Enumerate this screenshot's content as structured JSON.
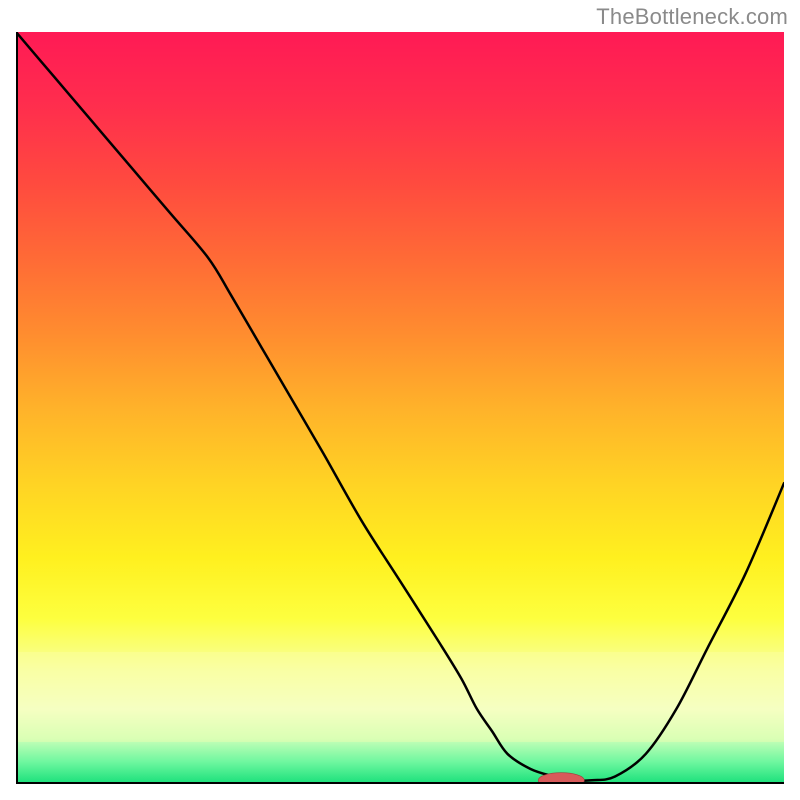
{
  "watermark": "TheBottleneck.com",
  "chart_data": {
    "type": "line",
    "title": "",
    "xlabel": "",
    "ylabel": "",
    "xlim": [
      0,
      100
    ],
    "ylim": [
      0,
      100
    ],
    "grid": false,
    "legend": false,
    "background_gradient": {
      "stops": [
        {
          "offset": 0.0,
          "color": "#ff1a55"
        },
        {
          "offset": 0.1,
          "color": "#ff2e4d"
        },
        {
          "offset": 0.2,
          "color": "#ff4a3f"
        },
        {
          "offset": 0.3,
          "color": "#ff6a36"
        },
        {
          "offset": 0.4,
          "color": "#ff8c2f"
        },
        {
          "offset": 0.5,
          "color": "#ffb22a"
        },
        {
          "offset": 0.6,
          "color": "#ffd324"
        },
        {
          "offset": 0.7,
          "color": "#fff01f"
        },
        {
          "offset": 0.78,
          "color": "#fdff3f"
        },
        {
          "offset": 0.85,
          "color": "#f8ffa0"
        },
        {
          "offset": 0.9,
          "color": "#f2ffcc"
        },
        {
          "offset": 0.94,
          "color": "#c8ffb8"
        },
        {
          "offset": 0.97,
          "color": "#70f7a0"
        },
        {
          "offset": 1.0,
          "color": "#18e07a"
        }
      ]
    },
    "series": [
      {
        "name": "bottleneck-curve",
        "color": "#000000",
        "stroke_width": 2.5,
        "x": [
          0,
          5,
          10,
          15,
          20,
          25,
          28,
          32,
          36,
          40,
          45,
          50,
          55,
          58,
          60,
          62,
          64,
          67,
          70,
          72,
          75,
          78,
          82,
          86,
          90,
          95,
          100
        ],
        "values": [
          100,
          94,
          88,
          82,
          76,
          70,
          65,
          58,
          51,
          44,
          35,
          27,
          19,
          14,
          10,
          7,
          4,
          2,
          1,
          0.5,
          0.5,
          1,
          4,
          10,
          18,
          28,
          40
        ]
      }
    ],
    "marker": {
      "name": "optimal-point",
      "x": 71,
      "y": 0.5,
      "rx": 3,
      "ry": 1,
      "color": "#d85a5a"
    },
    "axes": {
      "color": "#000000",
      "width": 4
    }
  }
}
